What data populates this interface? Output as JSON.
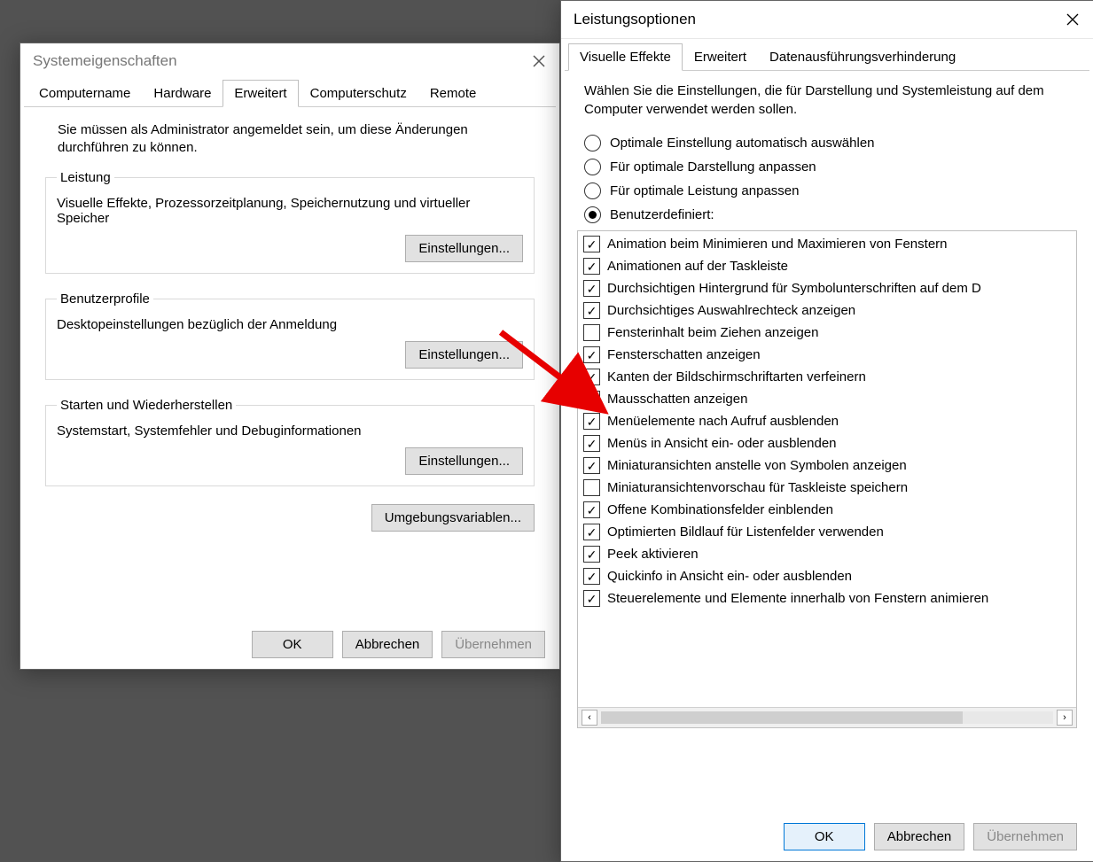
{
  "systemProps": {
    "title": "Systemeigenschaften",
    "tabs": [
      "Computername",
      "Hardware",
      "Erweitert",
      "Computerschutz",
      "Remote"
    ],
    "activeTab": 2,
    "info": "Sie müssen als Administrator angemeldet sein, um diese Änderungen durchführen zu können.",
    "sections": [
      {
        "legend": "Leistung",
        "desc": "Visuelle Effekte, Prozessorzeitplanung, Speichernutzung und virtueller Speicher",
        "button": "Einstellungen..."
      },
      {
        "legend": "Benutzerprofile",
        "desc": "Desktopeinstellungen bezüglich der Anmeldung",
        "button": "Einstellungen..."
      },
      {
        "legend": "Starten und Wiederherstellen",
        "desc": "Systemstart, Systemfehler und Debuginformationen",
        "button": "Einstellungen..."
      }
    ],
    "envVarsButton": "Umgebungsvariablen...",
    "buttons": {
      "ok": "OK",
      "cancel": "Abbrechen",
      "apply": "Übernehmen"
    }
  },
  "perfOptions": {
    "title": "Leistungsoptionen",
    "tabs": [
      "Visuelle Effekte",
      "Erweitert",
      "Datenausführungsverhinderung"
    ],
    "activeTab": 0,
    "intro": "Wählen Sie die Einstellungen, die für Darstellung und Systemleistung auf dem Computer verwendet werden sollen.",
    "radios": [
      "Optimale Einstellung automatisch auswählen",
      "Für optimale Darstellung anpassen",
      "Für optimale Leistung anpassen",
      "Benutzerdefiniert:"
    ],
    "selectedRadio": 3,
    "checks": [
      {
        "label": "Animation beim Minimieren und Maximieren von Fenstern",
        "checked": true
      },
      {
        "label": "Animationen auf der Taskleiste",
        "checked": true
      },
      {
        "label": "Durchsichtigen Hintergrund für Symbolunterschriften auf dem D",
        "checked": true
      },
      {
        "label": "Durchsichtiges Auswahlrechteck anzeigen",
        "checked": true
      },
      {
        "label": "Fensterinhalt beim Ziehen anzeigen",
        "checked": false
      },
      {
        "label": "Fensterschatten anzeigen",
        "checked": true
      },
      {
        "label": "Kanten der Bildschirmschriftarten verfeinern",
        "checked": true
      },
      {
        "label": "Mausschatten anzeigen",
        "checked": false
      },
      {
        "label": "Menüelemente nach Aufruf ausblenden",
        "checked": true
      },
      {
        "label": "Menüs in Ansicht ein- oder ausblenden",
        "checked": true
      },
      {
        "label": "Miniaturansichten anstelle von Symbolen anzeigen",
        "checked": true
      },
      {
        "label": "Miniaturansichtenvorschau für Taskleiste speichern",
        "checked": false
      },
      {
        "label": "Offene Kombinationsfelder einblenden",
        "checked": true
      },
      {
        "label": "Optimierten Bildlauf für Listenfelder verwenden",
        "checked": true
      },
      {
        "label": "Peek aktivieren",
        "checked": true
      },
      {
        "label": "Quickinfo in Ansicht ein- oder ausblenden",
        "checked": true
      },
      {
        "label": "Steuerelemente und Elemente innerhalb von Fenstern animieren",
        "checked": true
      }
    ],
    "buttons": {
      "ok": "OK",
      "cancel": "Abbrechen",
      "apply": "Übernehmen"
    }
  }
}
